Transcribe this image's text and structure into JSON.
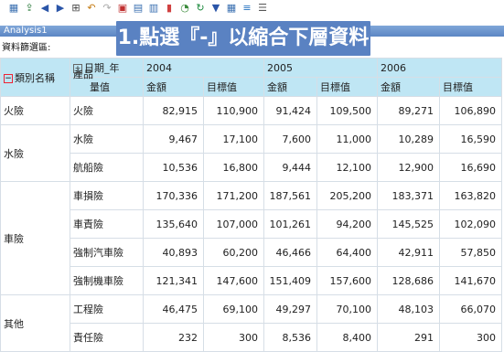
{
  "toolbar": {
    "icons": [
      "grid-icon",
      "export-icon",
      "prev-icon",
      "next-icon",
      "hierarchy-icon",
      "undo-icon",
      "redo-icon",
      "chart-icon",
      "table-icon",
      "layout-icon",
      "bar-chart-icon",
      "pie-chart-icon",
      "refresh-icon",
      "filter-icon",
      "grid-settings-icon",
      "database-icon",
      "properties-icon"
    ]
  },
  "analysis_title": "Analysis1",
  "filter_area_label": "資料篩選區:",
  "callout": "1.點選『-』以縮合下層資料",
  "header": {
    "toggle_symbol": "−",
    "category_label": "類別名稱",
    "product_label": "產品",
    "date_field_label": "日期_年",
    "measure_values_label": "量值",
    "years": [
      "2004",
      "2005",
      "2006"
    ],
    "measures": [
      "金額",
      "目標值",
      "金額",
      "目標值",
      "金額",
      "目標值"
    ]
  },
  "rows": [
    {
      "category": "火險",
      "product": "火險",
      "values": [
        "82,915",
        "110,900",
        "91,424",
        "109,500",
        "89,271",
        "106,890"
      ]
    },
    {
      "category": "水險",
      "product": "水險",
      "values": [
        "9,467",
        "17,100",
        "7,600",
        "11,000",
        "10,289",
        "16,590"
      ]
    },
    {
      "category": "",
      "product": "航船險",
      "values": [
        "10,536",
        "16,800",
        "9,444",
        "12,100",
        "12,900",
        "16,690"
      ]
    },
    {
      "category": "車險",
      "product": "車損險",
      "values": [
        "170,336",
        "171,200",
        "187,561",
        "205,200",
        "183,371",
        "163,820"
      ]
    },
    {
      "category": "",
      "product": "車責險",
      "values": [
        "135,640",
        "107,000",
        "101,261",
        "94,200",
        "145,525",
        "102,090"
      ]
    },
    {
      "category": "",
      "product": "強制汽車險",
      "values": [
        "40,893",
        "60,200",
        "46,466",
        "64,400",
        "42,911",
        "57,850"
      ]
    },
    {
      "category": "",
      "product": "強制機車險",
      "values": [
        "121,341",
        "147,600",
        "151,409",
        "157,600",
        "128,686",
        "141,670"
      ]
    },
    {
      "category": "其他",
      "product": "工程險",
      "values": [
        "46,475",
        "69,100",
        "49,297",
        "70,100",
        "48,103",
        "66,070"
      ]
    },
    {
      "category": "",
      "product": "責任險",
      "values": [
        "232",
        "300",
        "8,536",
        "8,400",
        "291",
        "300"
      ]
    }
  ]
}
